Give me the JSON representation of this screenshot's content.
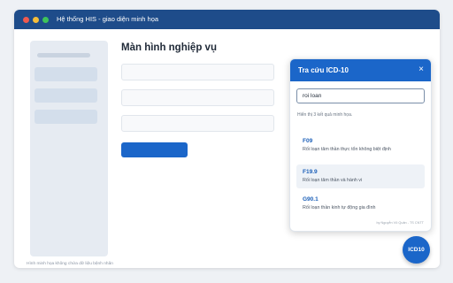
{
  "window": {
    "title": "Hệ thống HIS - giao diện minh họa"
  },
  "main": {
    "title": "Màn hình nghiệp vụ"
  },
  "footer": {
    "note": "Hình minh họa không chứa dữ liệu bệnh nhân"
  },
  "icd_panel": {
    "title": "Tra cứu ICD-10",
    "close_label": "×",
    "search_value": "roi loan",
    "result_info": "Hiển thị 3 kết quả minh họa.",
    "results": [
      {
        "code": "F09",
        "desc": "Rối loạn tâm thần thực tổn không biệt định"
      },
      {
        "code": "F19.9",
        "desc": "Rối loạn tâm thần và hành vi"
      },
      {
        "code": "G90.1",
        "desc": "Rối loạn thần kinh tự động gia đình"
      }
    ],
    "credit": "by Nguyễn Võ Quân - TS CNTT"
  },
  "fab": {
    "label": "ICD10"
  },
  "colors": {
    "brand_blue": "#1b66c9",
    "titlebar": "#1e4c8a"
  }
}
